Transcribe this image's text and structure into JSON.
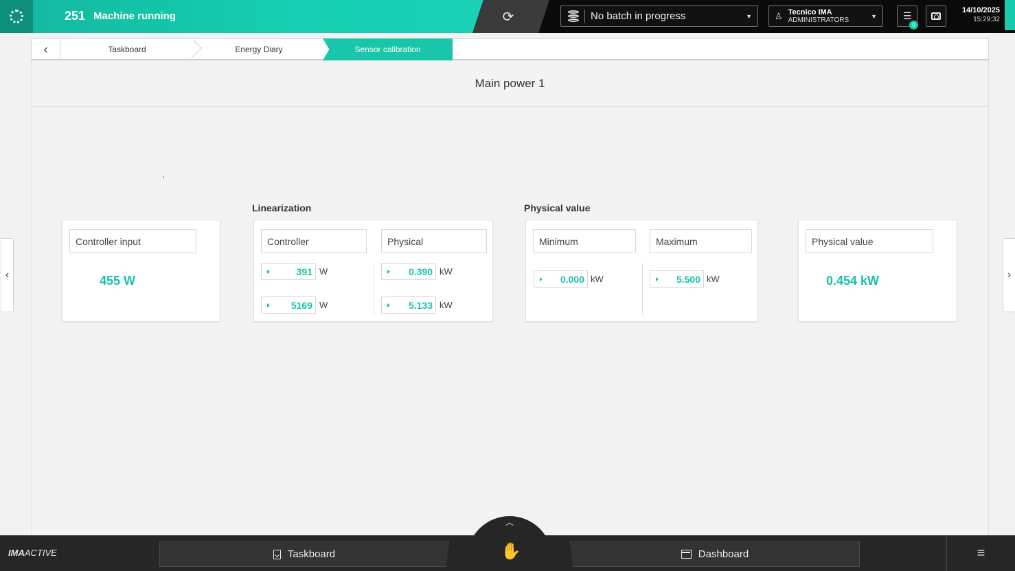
{
  "header": {
    "machine_code": "251",
    "machine_status": "Machine running",
    "batch": "No batch in progress",
    "user_name": "Tecnico IMA",
    "user_role": "ADMINISTRATORS",
    "message_count": "0",
    "date": "14/10/2025",
    "time": "15:29:32",
    "accent_color": "#18c2a8"
  },
  "breadcrumb": {
    "items": [
      "Taskboard",
      "Energy Diary"
    ],
    "active": "Sensor calibration"
  },
  "page": {
    "title": "Main power 1"
  },
  "controller_input": {
    "label": "Controller input",
    "value": "455 W"
  },
  "linearization": {
    "section_label": "Linearization",
    "controller_label": "Controller",
    "physical_label": "Physical",
    "rows": [
      {
        "controller": "391",
        "controller_unit": "W",
        "physical": "0.390",
        "physical_unit": "kW"
      },
      {
        "controller": "5169",
        "controller_unit": "W",
        "physical": "5.133",
        "physical_unit": "kW"
      }
    ]
  },
  "physical_range": {
    "section_label": "Physical value",
    "min_label": "Minimum",
    "min_value": "0.000",
    "min_unit": "kW",
    "max_label": "Maximum",
    "max_value": "5.500",
    "max_unit": "kW"
  },
  "physical_value": {
    "label": "Physical value",
    "value": "0.454 kW"
  },
  "footer": {
    "brand_bold": "IMA",
    "brand_rest": "ACTIVE",
    "taskboard_label": "Taskboard",
    "dashboard_label": "Dashboard"
  }
}
